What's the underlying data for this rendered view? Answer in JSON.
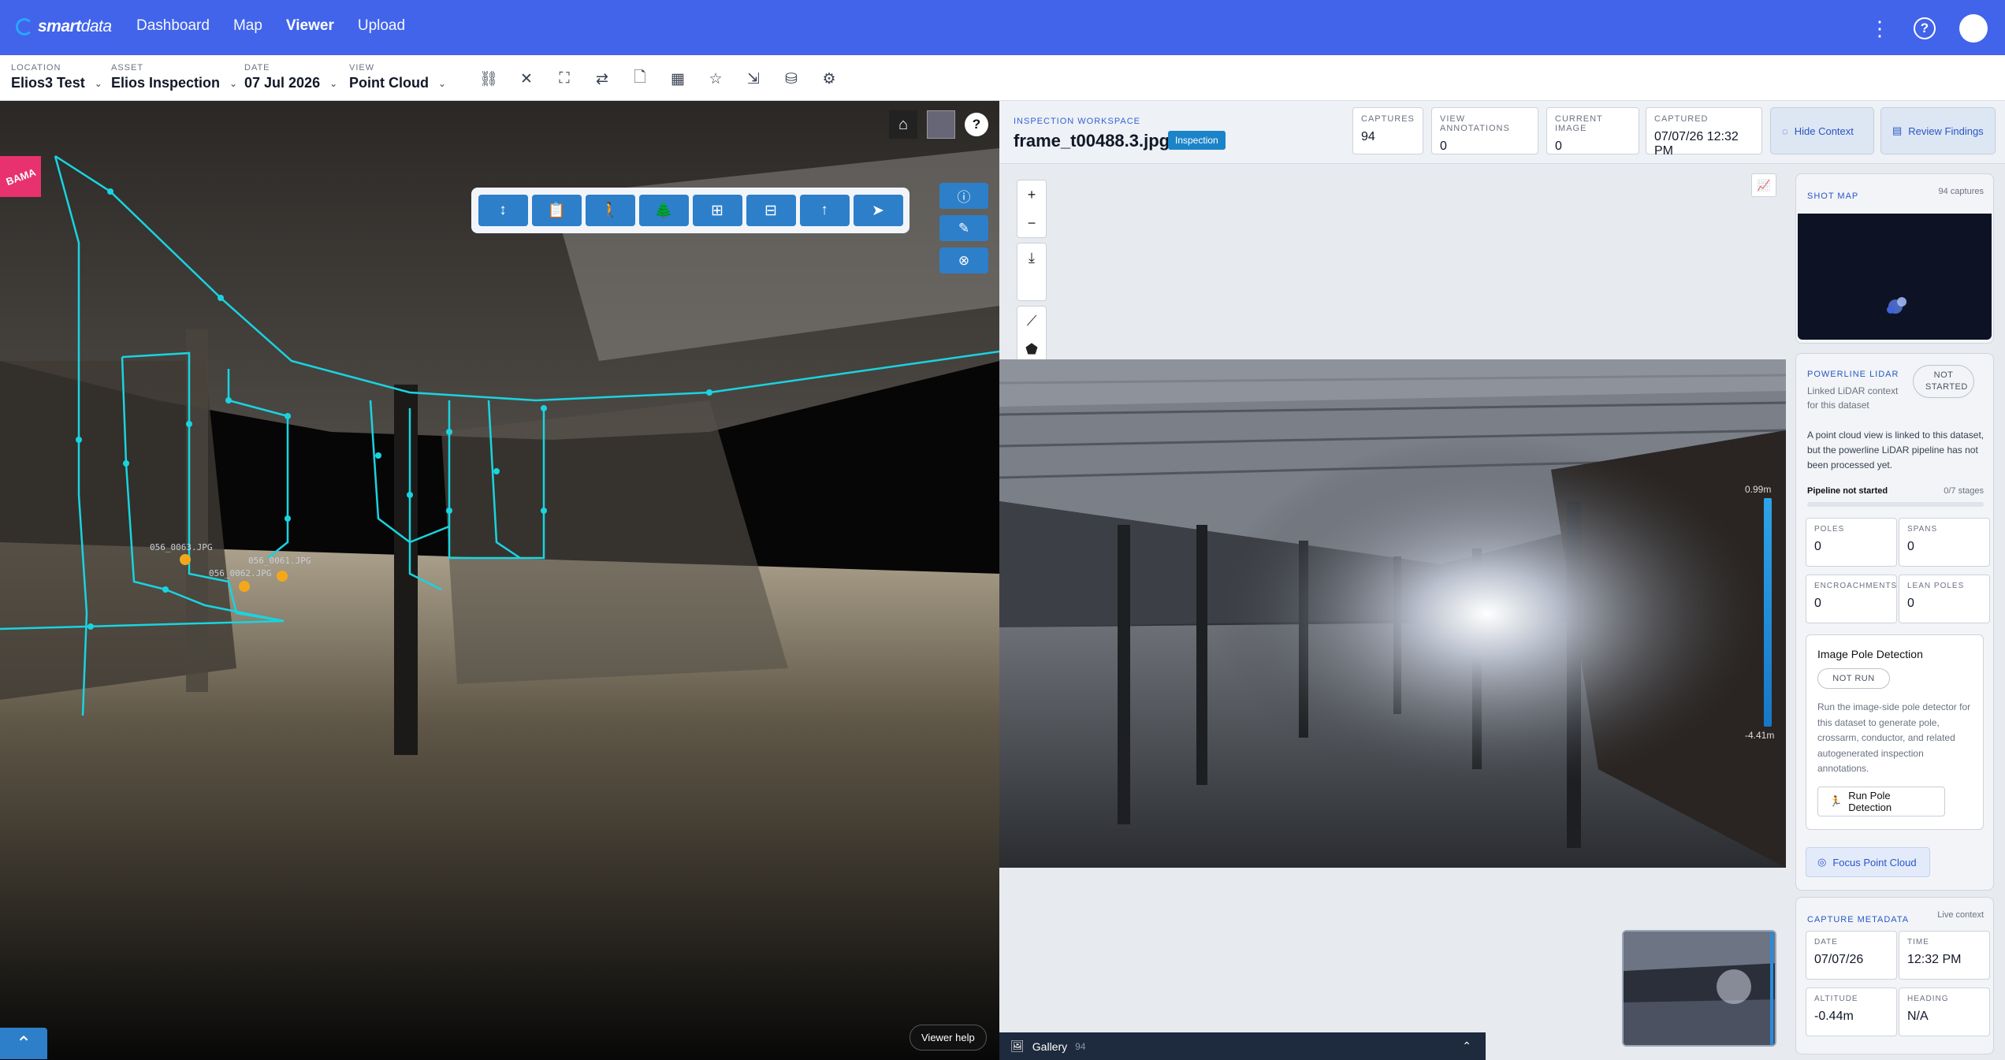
{
  "app": {
    "brand_bold": "smart",
    "brand_light": "data"
  },
  "nav": [
    "Dashboard",
    "Map",
    "Viewer",
    "Upload"
  ],
  "filters": [
    {
      "label": "LOCATION",
      "value": "Elios3 Test"
    },
    {
      "label": "ASSET",
      "value": "Elios Inspection"
    },
    {
      "label": "DATE",
      "value": "07 Jul 2026"
    },
    {
      "label": "VIEW",
      "value": "Point Cloud"
    }
  ],
  "pointcloud": {
    "tag": "BAMA",
    "help_label": "Viewer help",
    "labels": [
      "056_0063.JPG",
      "056_0062.JPG",
      "056_0061.JPG"
    ]
  },
  "workspace": {
    "kicker": "INSPECTION WORKSPACE",
    "filename": "frame_t00488.3.jpg",
    "badge": "Inspection",
    "stats": [
      {
        "label": "CAPTURES",
        "value": "94"
      },
      {
        "label": "VIEW ANNOTATIONS",
        "value": "0"
      },
      {
        "label": "CURRENT IMAGE",
        "value": "0"
      },
      {
        "label": "CAPTURED",
        "value": "07/07/26 12:32 PM"
      }
    ],
    "hide_context": "Hide Context",
    "review_findings": "Review Findings",
    "depth_top": "0.99m",
    "depth_bottom": "-4.41m",
    "size_label": "XL",
    "gallery_label": "Gallery",
    "gallery_count": "94"
  },
  "shot_map": {
    "title": "SHOT MAP",
    "meta": "94 captures"
  },
  "lidar": {
    "title": "POWERLINE LIDAR",
    "status": "NOT STARTED",
    "subtitle": "Linked LiDAR context for this dataset",
    "body": "A point cloud view is linked to this dataset, but the powerline LiDAR pipeline has not been processed yet.",
    "pipeline_label": "Pipeline not started",
    "pipeline_stages": "0/7 stages",
    "pipeline_progress": 0,
    "stats": [
      {
        "label": "POLES",
        "value": "0"
      },
      {
        "label": "SPANS",
        "value": "0"
      },
      {
        "label": "ENCROACHMENTS",
        "value": "0"
      },
      {
        "label": "LEAN POLES",
        "value": "0"
      }
    ],
    "detect_title": "Image Pole Detection",
    "detect_status": "NOT RUN",
    "detect_body": "Run the image-side pole detector for this dataset to generate pole, crossarm, conductor, and related autogenerated inspection annotations.",
    "run_label": "Run Pole Detection",
    "focus_label": "Focus Point Cloud"
  },
  "capture_meta": {
    "title": "CAPTURE METADATA",
    "meta": "Live context",
    "fields": [
      {
        "label": "DATE",
        "value": "07/07/26"
      },
      {
        "label": "TIME",
        "value": "12:32 PM"
      },
      {
        "label": "ALTITUDE",
        "value": "-0.44m"
      },
      {
        "label": "HEADING",
        "value": "N/A"
      }
    ]
  }
}
